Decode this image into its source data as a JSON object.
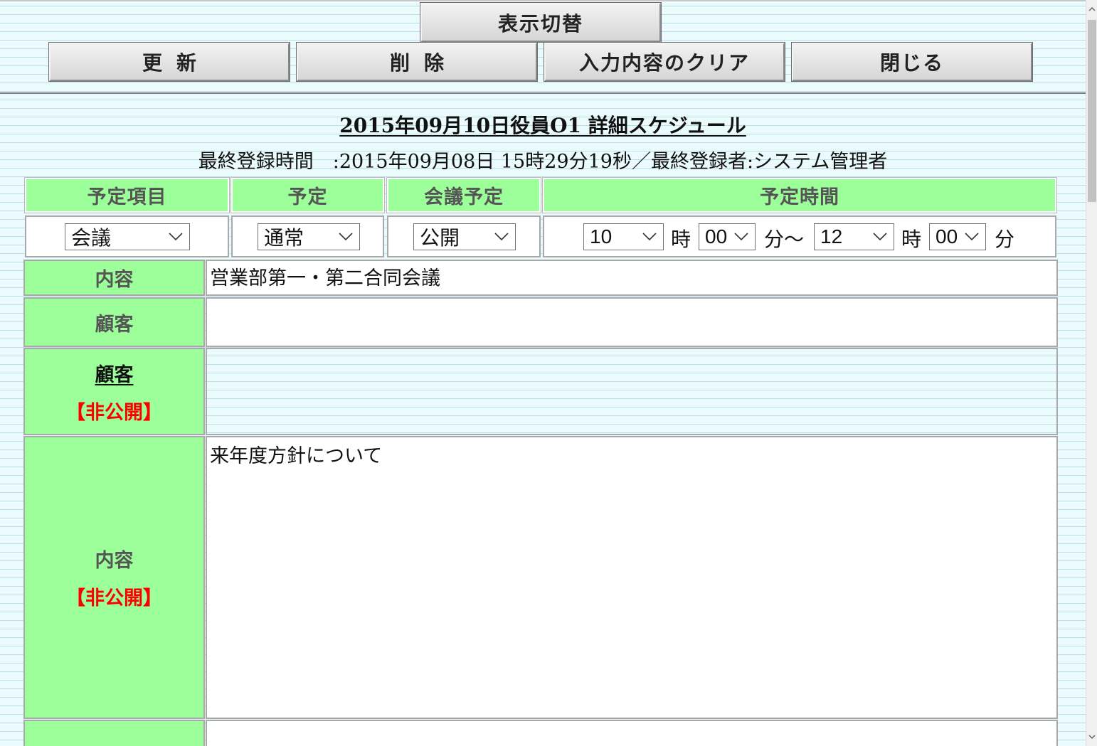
{
  "toolbar": {
    "toggle_view": "表示切替",
    "update": "更新",
    "delete": "削除",
    "clear": "入力内容のクリア",
    "close": "閉じる"
  },
  "header": {
    "title": "2015年09月10日役員O1 詳細スケジュール",
    "last_registered": "最終登録時間　:2015年09月08日 15時29分19秒／最終登録者:システム管理者"
  },
  "schedule": {
    "headers": [
      "予定項目",
      "予定",
      "会議予定",
      "予定時間"
    ],
    "item_select": "会議",
    "type_select": "通常",
    "meeting_select": "公開",
    "start_hour": "10",
    "start_minute": "00",
    "end_hour": "12",
    "end_minute": "00",
    "unit_hour": "時",
    "unit_minute_tilde": "分～",
    "unit_hour2": "時",
    "unit_minute": "分"
  },
  "fields": {
    "content_label": "内容",
    "content_value": "営業部第一・第二合同会議",
    "customer_label": "顧客",
    "customer_value": "",
    "customer_private_label": "顧客",
    "private_tag": "【非公開】",
    "content_private_label": "内容",
    "content_private_value": "来年度方針について"
  },
  "colors": {
    "header_green": "#9dff9a",
    "private_red": "#ff0000",
    "background_stripe": "#b9e0e6"
  }
}
